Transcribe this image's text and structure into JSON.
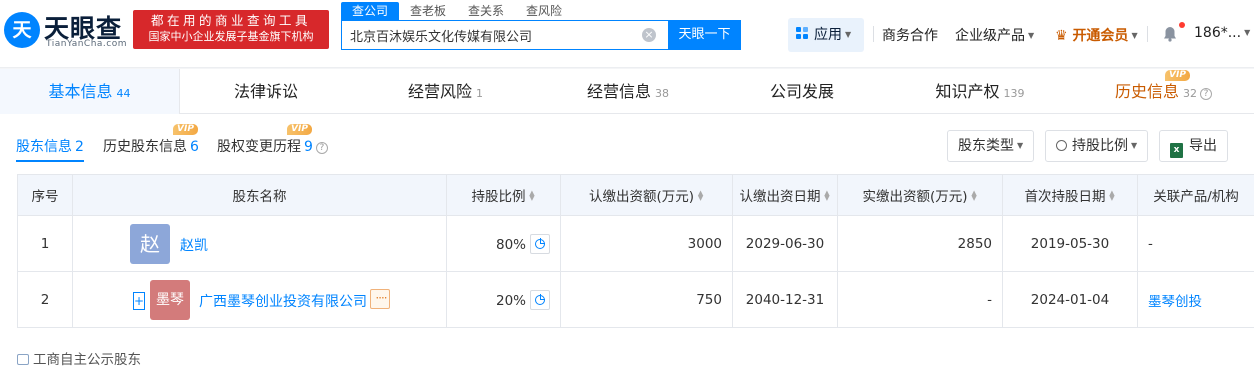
{
  "brand": {
    "logo_mark": "天",
    "name_cn": "天眼查",
    "name_en": "TianYanCha.com",
    "slogan_line1": "都在用的商业查询工具",
    "slogan_line2": "国家中小企业发展子基金旗下机构"
  },
  "search": {
    "tabs": [
      "查公司",
      "查老板",
      "查关系",
      "查风险"
    ],
    "active_tab": "查公司",
    "value": "北京百沐娱乐文化传媒有限公司",
    "button_label": "天眼一下"
  },
  "topnav": {
    "apps_label": "应用",
    "business_label": "商务合作",
    "enterprise_label": "企业级产品",
    "vip_label": "开通会员",
    "user_label": "186*..."
  },
  "tabs": [
    {
      "label": "基本信息",
      "count": "44"
    },
    {
      "label": "法律诉讼",
      "count": ""
    },
    {
      "label": "经营风险",
      "count": "1"
    },
    {
      "label": "经营信息",
      "count": "38"
    },
    {
      "label": "公司发展",
      "count": ""
    },
    {
      "label": "知识产权",
      "count": "139"
    },
    {
      "label": "历史信息",
      "count": "32"
    }
  ],
  "vip_badge": "VIP",
  "subtabs": [
    {
      "label": "股东信息",
      "count": "2"
    },
    {
      "label": "历史股东信息",
      "count": "6"
    },
    {
      "label": "股权变更历程",
      "count": "9"
    }
  ],
  "filters": {
    "shareholder_type": "股东类型",
    "share_ratio": "持股比例",
    "export": "导出"
  },
  "table": {
    "headers": [
      "序号",
      "股东名称",
      "持股比例",
      "认缴出资额(万元)",
      "认缴出资日期",
      "实缴出资额(万元)",
      "首次持股日期",
      "关联产品/机构"
    ],
    "rows": [
      {
        "index": "1",
        "avatar": "赵",
        "avatar_color": "#8da7d9",
        "name": "赵凯",
        "ratio": "80%",
        "subscribed": "3000",
        "subscribe_date": "2029-06-30",
        "paid": "2850",
        "first_date": "2019-05-30",
        "related": "-"
      },
      {
        "index": "2",
        "avatar": "墨琴",
        "avatar_color": "#d37b7b",
        "name": "广西墨琴创业投资有限公司",
        "ratio": "20%",
        "subscribed": "750",
        "subscribe_date": "2040-12-31",
        "paid": "-",
        "first_date": "2024-01-04",
        "related": "墨琴创投"
      }
    ]
  },
  "footnote": "工商自主公示股东"
}
